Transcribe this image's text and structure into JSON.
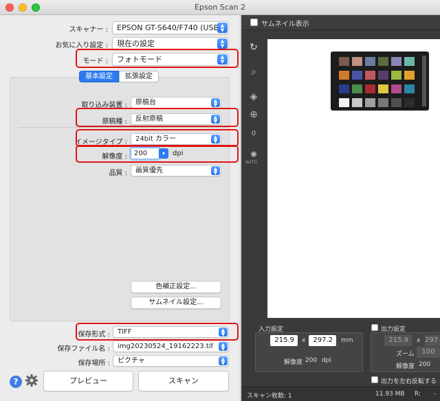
{
  "window": {
    "title": "Epson Scan 2"
  },
  "left": {
    "scanner": {
      "label": "スキャナー :",
      "value": "EPSON GT-S640/F740 (USB)"
    },
    "favorites": {
      "label": "お気に入り設定 :",
      "value": "現在の設定"
    },
    "mode": {
      "label": "モード :",
      "value": "フォトモード"
    },
    "tabs": {
      "basic": "基本設定",
      "advanced": "拡張設定"
    },
    "source": {
      "label": "取り込み装置 :",
      "value": "原稿台"
    },
    "doc_type": {
      "label": "原稿種 :",
      "value": "反射原稿"
    },
    "image_type": {
      "label": "イメージタイプ :",
      "value": "24bit カラー"
    },
    "resolution": {
      "label": "解像度 :",
      "value": "200",
      "unit": "dpi"
    },
    "quality": {
      "label": "品質 :",
      "value": "画質優先"
    },
    "color_correction_button": "色補正設定...",
    "thumbnail_button": "サムネイル設定...",
    "save_format": {
      "label": "保存形式 :",
      "value": "TIFF"
    },
    "file_name": {
      "label": "保存ファイル名 :",
      "value": "img20230524_19162223.tif"
    },
    "save_location": {
      "label": "保存場所 :",
      "value": "ピクチャ"
    },
    "preview_button": "プレビュー",
    "scan_button": "スキャン",
    "help_icon": "?"
  },
  "right": {
    "thumbnail_label": "サムネイル表示",
    "auto_label": "AUTO",
    "tool_count": "0",
    "input_settings": {
      "title": "入力設定",
      "width": "215.9",
      "times": "x",
      "height": "297.2",
      "unit": "mm",
      "resolution_label": "解像度",
      "resolution_value": "200",
      "resolution_unit": "dpi"
    },
    "output_settings": {
      "title": "出力設定",
      "width": "215.9",
      "times": "x",
      "height": "297",
      "zoom_label": "ズーム",
      "zoom_value": "100",
      "resolution_label": "解像度",
      "resolution_value": "200",
      "flip_label": "出力を左右反転する"
    },
    "status": {
      "scan_count_label": "スキャン枚数: 1",
      "size": "11.93 MB",
      "channel": "R:",
      "separator": "-"
    }
  },
  "highlight_color": "#e01414",
  "accent_color": "#2d7af0",
  "calibration_colors": [
    "#7a5a4c",
    "#c09080",
    "#6a7aa0",
    "#5a6c40",
    "#8a84b8",
    "#6ab8a8",
    "#d07a30",
    "#4a56a4",
    "#c05860",
    "#5a3c6c",
    "#98b840",
    "#e0a030",
    "#2c3c8c",
    "#4a8c4a",
    "#a82c30",
    "#e0c840",
    "#b04c8c",
    "#2c84a8",
    "#f2f2f2",
    "#c8c8c8",
    "#a0a0a0",
    "#787878",
    "#505050",
    "#2c2c2c"
  ]
}
